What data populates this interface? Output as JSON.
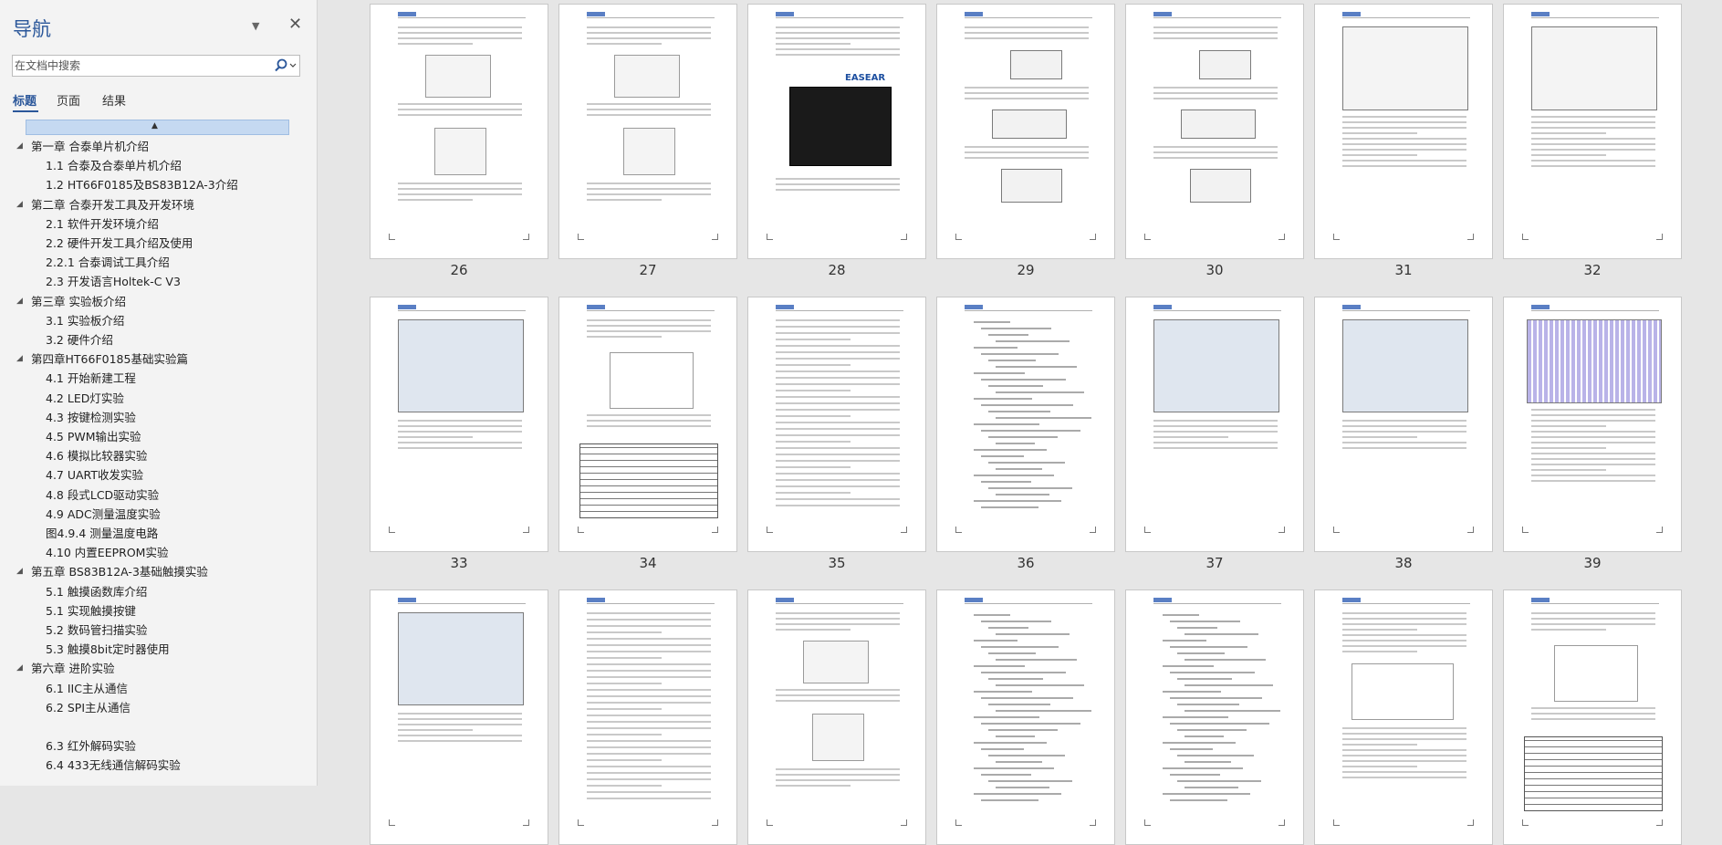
{
  "nav": {
    "title": "导航",
    "search": {
      "placeholder": "在文档中搜索"
    },
    "tabs": [
      {
        "label": "标题",
        "active": true
      },
      {
        "label": "页面",
        "active": false
      },
      {
        "label": "结果",
        "active": false
      }
    ],
    "outline": [
      {
        "level": 1,
        "label": "第一章 合泰单片机介绍"
      },
      {
        "level": 2,
        "label": "1.1 合泰及合泰单片机介绍"
      },
      {
        "level": 2,
        "label": "1.2 HT66F0185及BS83B12A-3介绍"
      },
      {
        "level": 1,
        "label": "第二章 合泰开发工具及开发环境"
      },
      {
        "level": 2,
        "label": "2.1 软件开发环境介绍"
      },
      {
        "level": 2,
        "label": "2.2 硬件开发工具介绍及使用"
      },
      {
        "level": 2,
        "label": "2.2.1 合泰调试工具介绍"
      },
      {
        "level": 2,
        "label": "2.3 开发语言Holtek-C  V3"
      },
      {
        "level": 1,
        "label": "第三章 实验板介绍"
      },
      {
        "level": 2,
        "label": "3.1 实验板介绍"
      },
      {
        "level": 2,
        "label": "3.2 硬件介绍"
      },
      {
        "level": 1,
        "label": "第四章HT66F0185基础实验篇"
      },
      {
        "level": 2,
        "label": "4.1 开始新建工程"
      },
      {
        "level": 2,
        "label": "4.2 LED灯实验"
      },
      {
        "level": 2,
        "label": "4.3 按键检测实验"
      },
      {
        "level": 2,
        "label": "4.5 PWM输出实验"
      },
      {
        "level": 2,
        "label": "4.6 模拟比较器实验"
      },
      {
        "level": 2,
        "label": "4.7 UART收发实验"
      },
      {
        "level": 2,
        "label": "4.8 段式LCD驱动实验"
      },
      {
        "level": 2,
        "label": "4.9 ADC测量温度实验"
      },
      {
        "level": 2,
        "label": "图4.9.4 测量温度电路"
      },
      {
        "level": 2,
        "label": "4.10 内置EEPROM实验"
      },
      {
        "level": 1,
        "label": "第五章  BS83B12A-3基础触摸实验"
      },
      {
        "level": 2,
        "label": "5.1 触摸函数库介绍"
      },
      {
        "level": 2,
        "label": "5.1 实现触摸按键"
      },
      {
        "level": 2,
        "label": "5.2 数码管扫描实验"
      },
      {
        "level": 2,
        "label": "5.3 触摸8bit定时器使用"
      },
      {
        "level": 1,
        "label": "第六章  进阶实验"
      },
      {
        "level": 2,
        "label": "6.1 IIC主从通信"
      },
      {
        "level": 2,
        "label": "6.2 SPI主从通信"
      },
      {
        "level": 2,
        "label": ""
      },
      {
        "level": 2,
        "label": "6.3 红外解码实验"
      },
      {
        "level": 2,
        "label": "6.4 433无线通信解码实验"
      }
    ]
  },
  "pages": [
    {
      "number": "26",
      "kind": "circuit"
    },
    {
      "number": "27",
      "kind": "circuit"
    },
    {
      "number": "28",
      "kind": "board"
    },
    {
      "number": "29",
      "kind": "dialogs"
    },
    {
      "number": "30",
      "kind": "dialogs"
    },
    {
      "number": "31",
      "kind": "screens"
    },
    {
      "number": "32",
      "kind": "screens"
    },
    {
      "number": "33",
      "kind": "ide"
    },
    {
      "number": "34",
      "kind": "table"
    },
    {
      "number": "35",
      "kind": "text"
    },
    {
      "number": "36",
      "kind": "code"
    },
    {
      "number": "37",
      "kind": "ide"
    },
    {
      "number": "38",
      "kind": "ide"
    },
    {
      "number": "39",
      "kind": "grid"
    },
    {
      "number": "",
      "kind": "ide"
    },
    {
      "number": "",
      "kind": "text"
    },
    {
      "number": "",
      "kind": "circuit"
    },
    {
      "number": "",
      "kind": "code"
    },
    {
      "number": "",
      "kind": "code"
    },
    {
      "number": "",
      "kind": "diagram"
    },
    {
      "number": "",
      "kind": "table"
    }
  ],
  "colors": {
    "accent": "#2b579a",
    "collapse_bar": "#c5d9f1",
    "board": "#1a1a1a"
  },
  "icons": {
    "dropdown": "chevron-down-icon",
    "close": "close-icon",
    "search": "search-icon",
    "collapse": "collapse-up-icon"
  },
  "board_label": "EASEAR"
}
